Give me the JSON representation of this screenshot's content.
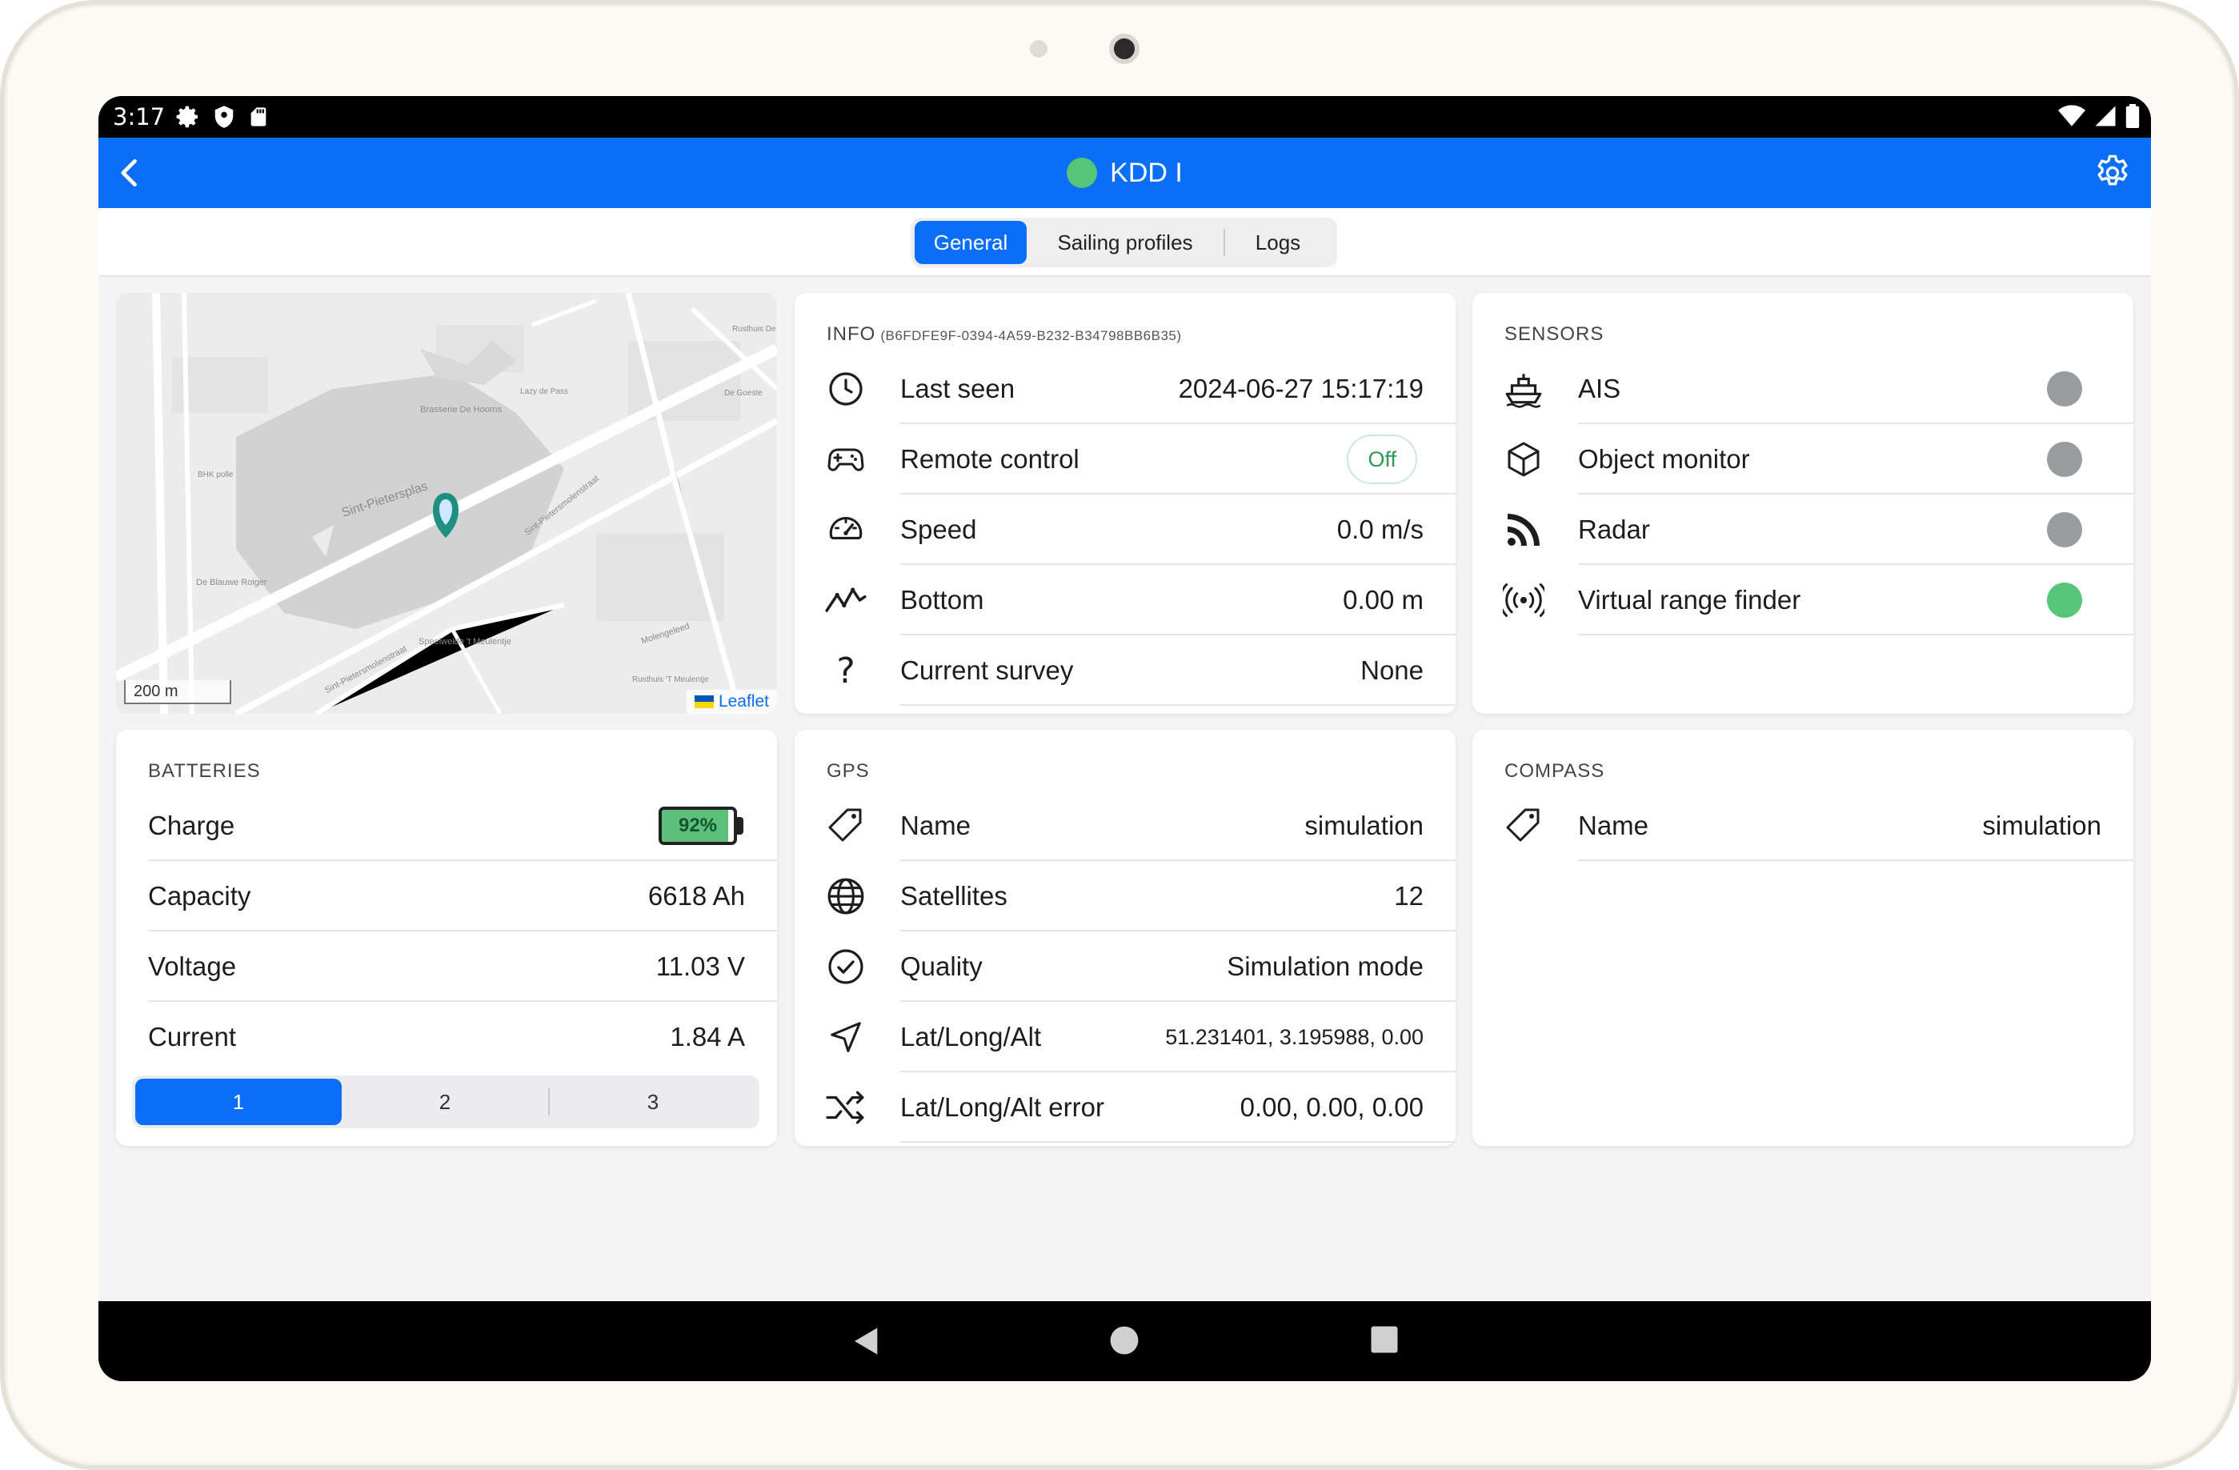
{
  "status_bar": {
    "time": "3:17"
  },
  "app_bar": {
    "title": "KDD I",
    "status_color": "#57c577"
  },
  "tabs": [
    {
      "label": "General",
      "active": true
    },
    {
      "label": "Sailing profiles",
      "active": false
    },
    {
      "label": "Logs",
      "active": false
    }
  ],
  "map": {
    "scale_label": "200 m",
    "attribution": "Leaflet",
    "labels": {
      "lake": "Sint-Pietersplas",
      "brasserie": "Brasserie De Hoorns",
      "street1": "Sint-Pietersmolenstraat",
      "street2": "Sint-Pietersmolenstraat",
      "blauwe": "De Blauwe Roiger",
      "speelweide": "Speelweide 't Meulentje",
      "molengeleed": "Molengeleed",
      "rusthuis": "Rusthuis 'T Meulentje",
      "goeste": "De Goeste",
      "lazy": "Lazy de Pass",
      "bhk": "BHK polle",
      "rusthuis2": "Rusthuis De"
    }
  },
  "info": {
    "title": "INFO",
    "id": "(B6FDFE9F-0394-4A59-B232-B34798BB6B35)",
    "rows": [
      {
        "icon": "clock-icon",
        "label": "Last seen",
        "value": "2024-06-27 15:17:19"
      },
      {
        "icon": "gamepad-icon",
        "label": "Remote control",
        "value": "Off"
      },
      {
        "icon": "speedometer-icon",
        "label": "Speed",
        "value": "0.0 m/s"
      },
      {
        "icon": "trend-line-icon",
        "label": "Bottom",
        "value": "0.00 m"
      },
      {
        "icon": "question-icon",
        "label": "Current survey",
        "value": "None"
      }
    ]
  },
  "sensors": {
    "title": "SENSORS",
    "rows": [
      {
        "icon": "ship-icon",
        "label": "AIS",
        "status_color": "#9a9b9d"
      },
      {
        "icon": "cube-icon",
        "label": "Object monitor",
        "status_color": "#9a9b9d"
      },
      {
        "icon": "rss-icon",
        "label": "Radar",
        "status_color": "#9a9b9d"
      },
      {
        "icon": "broadcast-icon",
        "label": "Virtual range finder",
        "status_color": "#57c577"
      }
    ]
  },
  "batteries": {
    "title": "BATTERIES",
    "charge_label": "Charge",
    "charge_text": "92%",
    "charge_fraction": 0.92,
    "rows": [
      {
        "label": "Capacity",
        "value": "6618 Ah"
      },
      {
        "label": "Voltage",
        "value": "11.03 V"
      },
      {
        "label": "Current",
        "value": "1.84 A"
      }
    ],
    "selector": [
      {
        "label": "1",
        "active": true
      },
      {
        "label": "2",
        "active": false
      },
      {
        "label": "3",
        "active": false
      }
    ]
  },
  "gps": {
    "title": "GPS",
    "rows": [
      {
        "icon": "tag-icon",
        "label": "Name",
        "value": "simulation"
      },
      {
        "icon": "globe-icon",
        "label": "Satellites",
        "value": "12"
      },
      {
        "icon": "check-circle-icon",
        "label": "Quality",
        "value": "Simulation mode"
      },
      {
        "icon": "navigation-arrow-icon",
        "label": "Lat/Long/Alt",
        "value": "51.231401, 3.195988, 0.00"
      },
      {
        "icon": "shuffle-icon",
        "label": "Lat/Long/Alt error",
        "value": "0.00, 0.00, 0.00"
      }
    ]
  },
  "compass": {
    "title": "COMPASS",
    "rows": [
      {
        "icon": "tag-icon",
        "label": "Name",
        "value": "simulation"
      }
    ]
  }
}
